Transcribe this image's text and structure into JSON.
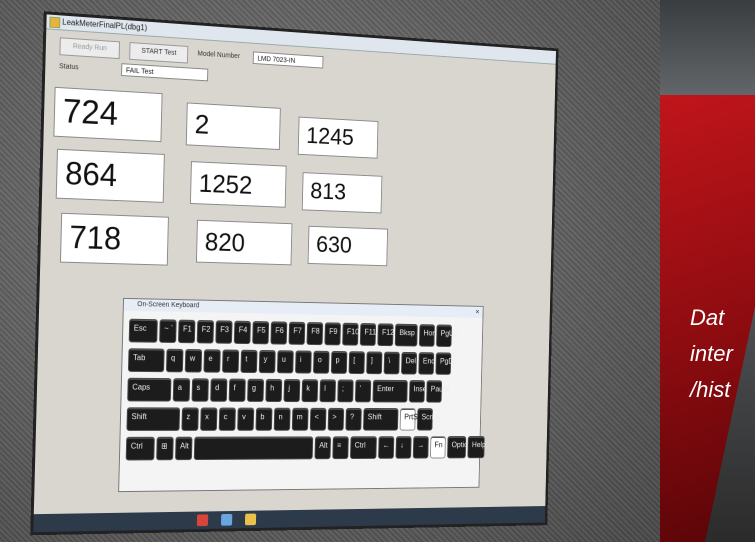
{
  "window": {
    "title": "LeakMeterFinalPL(dbg1)"
  },
  "toolbar": {
    "btn1": "Ready Run",
    "btn2": "START Test",
    "mode_label": "Model Number",
    "mode_value": "LMD 7023-IN"
  },
  "status": {
    "label": "Status",
    "value": "FAIL Test"
  },
  "readings": [
    "724",
    "2",
    "1245",
    "864",
    "1252",
    "813",
    "718",
    "820",
    "630"
  ],
  "keyboard": {
    "title": "On-Screen Keyboard",
    "close": "×",
    "rows": [
      [
        "Esc",
        "~ `",
        "F1",
        "F2",
        "F3",
        "F4",
        "F5",
        "F6",
        "F7",
        "F8",
        "F9",
        "F10",
        "F11",
        "F12",
        "Bksp",
        "Home",
        "PgUp"
      ],
      [
        "Tab",
        "q",
        "w",
        "e",
        "r",
        "t",
        "y",
        "u",
        "i",
        "o",
        "p",
        "[",
        "]",
        "\\",
        "Del",
        "End",
        "PgDn"
      ],
      [
        "Caps",
        "a",
        "s",
        "d",
        "f",
        "g",
        "h",
        "j",
        "k",
        "l",
        ";",
        "'",
        "Enter",
        "Insert",
        "Pause"
      ],
      [
        "Shift",
        "z",
        "x",
        "c",
        "v",
        "b",
        "n",
        "m",
        "<",
        ">",
        "?",
        "Shift",
        "PrtScn",
        "ScrLk"
      ],
      [
        "Ctrl",
        "⊞",
        "Alt",
        "",
        "Alt",
        "≡",
        "Ctrl",
        "←",
        "↓",
        "→",
        "Fn",
        "Options",
        "Help"
      ]
    ]
  },
  "side_text": [
    "Dat",
    "inter",
    "/hist"
  ],
  "colors": {
    "accent_red": "#c4161c",
    "screen_bg": "#d9d6cf"
  }
}
